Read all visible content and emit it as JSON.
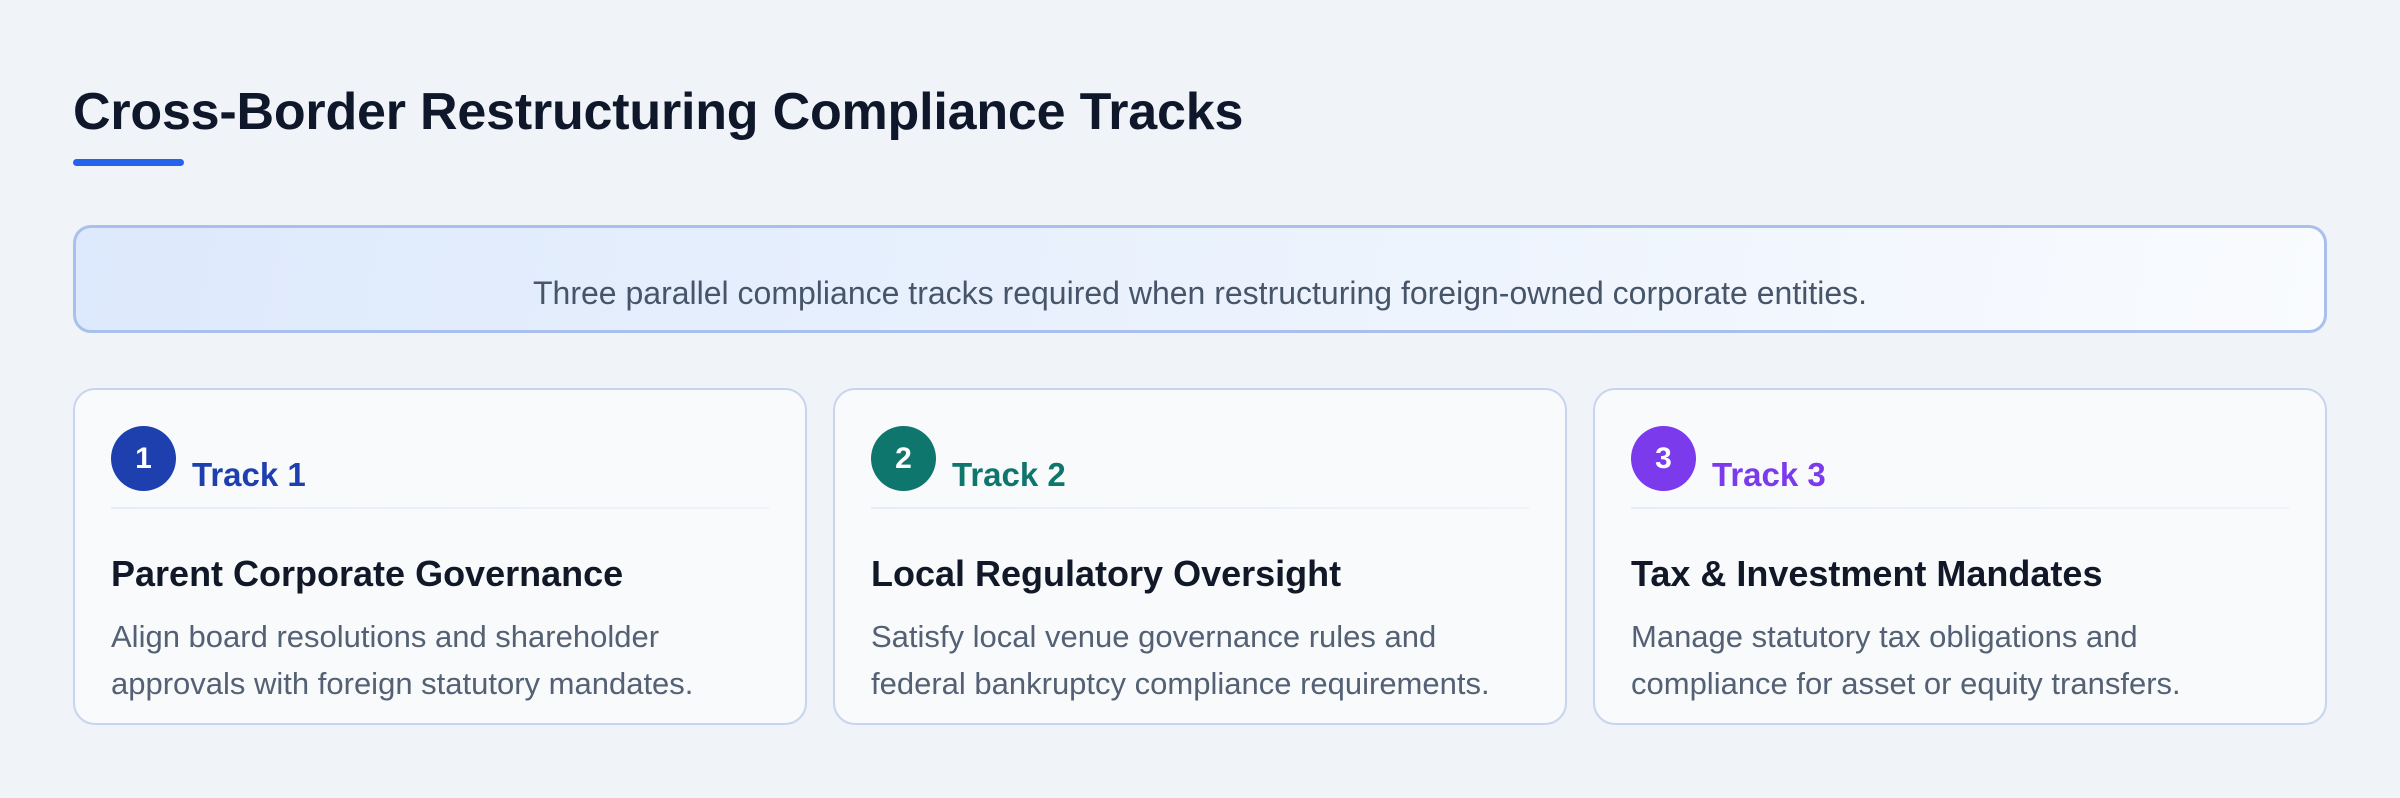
{
  "header": {
    "title": "Cross-Border Restructuring Compliance Tracks"
  },
  "banner": {
    "text": "Three parallel compliance tracks required when restructuring foreign-owned corporate entities."
  },
  "colors": {
    "accent": "#2563eb",
    "track1": "#1e40af",
    "track2": "#0f766e",
    "track3": "#7c3aed"
  },
  "tracks": [
    {
      "number": "1",
      "label": "Track 1",
      "title": "Parent Corporate Governance",
      "line1": "Align board resolutions and shareholder",
      "line2": "approvals with foreign statutory mandates."
    },
    {
      "number": "2",
      "label": "Track 2",
      "title": "Local Regulatory Oversight",
      "line1": "Satisfy local venue governance rules and",
      "line2": "federal bankruptcy compliance requirements."
    },
    {
      "number": "3",
      "label": "Track 3",
      "title": "Tax & Investment Mandates",
      "line1": "Manage statutory tax obligations and",
      "line2": "compliance for asset or equity transfers."
    }
  ]
}
